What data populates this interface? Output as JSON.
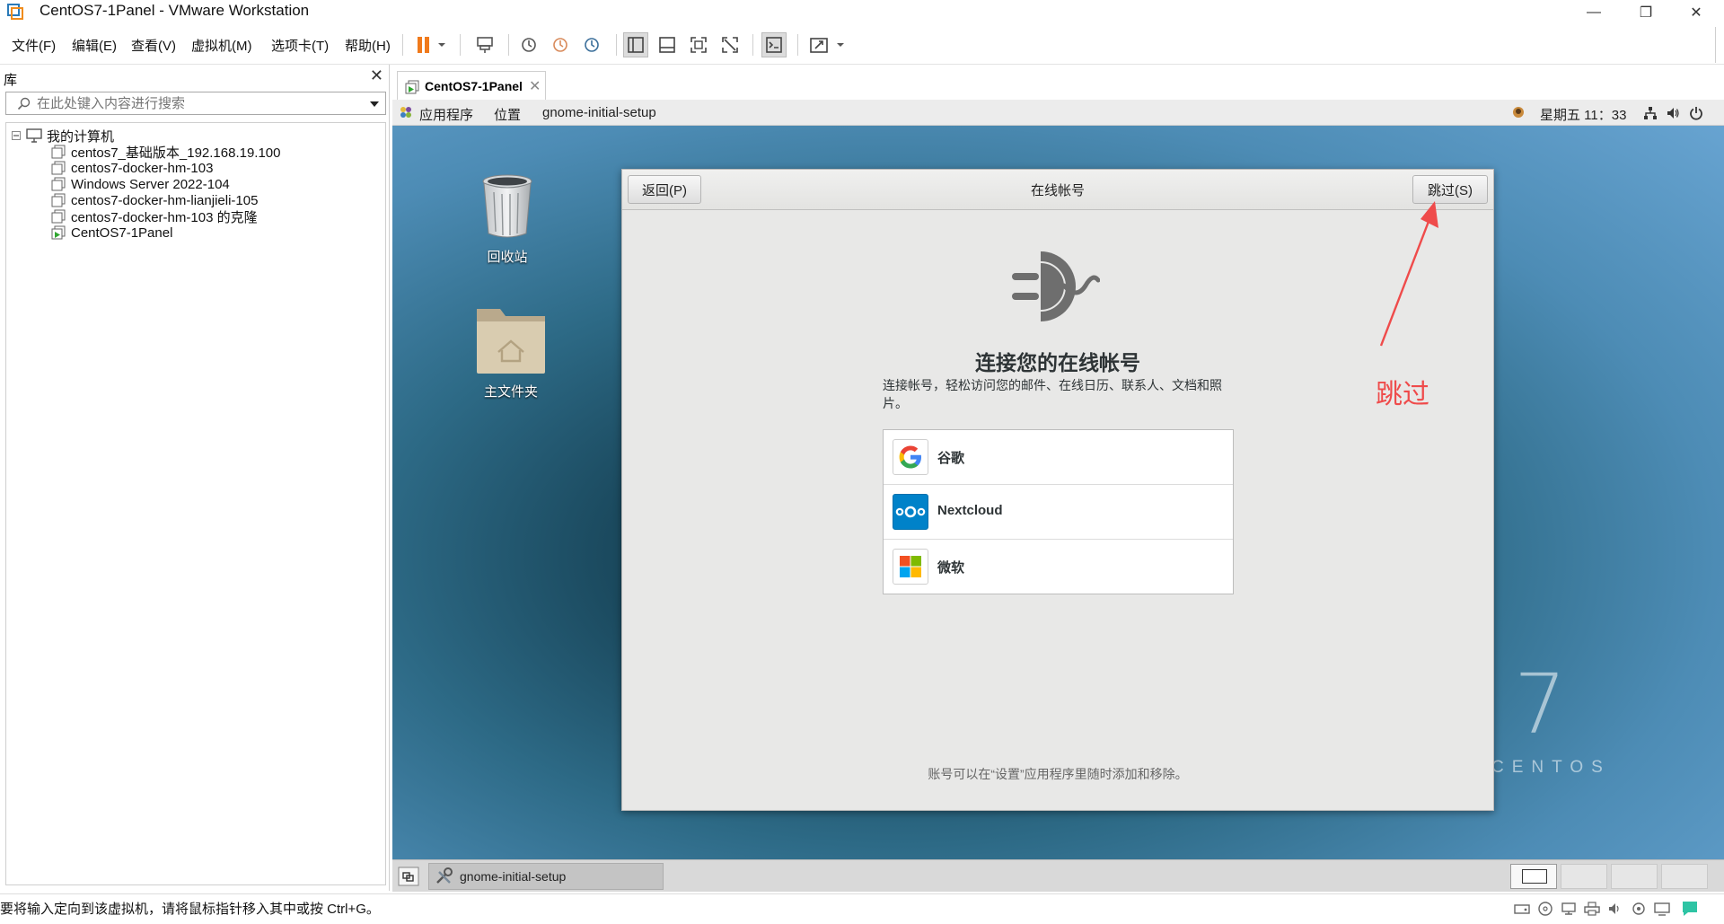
{
  "window": {
    "title": "CentOS7-1Panel - VMware Workstation",
    "minimize": "—",
    "restore": "❐",
    "close": "✕"
  },
  "menu": {
    "items": [
      "文件(F)",
      "编辑(E)",
      "查看(V)",
      "虚拟机(M)",
      "选项卡(T)",
      "帮助(H)"
    ]
  },
  "library": {
    "title": "库",
    "close": "✕",
    "search_placeholder": "在此处键入内容进行搜索",
    "root": "我的计算机",
    "items": [
      {
        "label": "centos7_基础版本_192.168.19.100",
        "running": false
      },
      {
        "label": "centos7-docker-hm-103",
        "running": false
      },
      {
        "label": "Windows Server 2022-104",
        "running": false
      },
      {
        "label": "centos7-docker-hm-lianjieli-105",
        "running": false
      },
      {
        "label": "centos7-docker-hm-103 的克隆",
        "running": false
      },
      {
        "label": "CentOS7-1Panel",
        "running": true
      }
    ]
  },
  "tab": {
    "label": "CentOS7-1Panel",
    "close": "✕"
  },
  "gnome_panel": {
    "apps": "应用程序",
    "places": "位置",
    "current_app": "gnome-initial-setup",
    "clock": "星期五 11：33"
  },
  "desktop": {
    "trash_label": "回收站",
    "home_label": "主文件夹",
    "centos_number": "7",
    "centos_word": "CENTOS"
  },
  "dialog": {
    "back": "返回(P)",
    "title": "在线帐号",
    "skip": "跳过(S)",
    "heading": "连接您的在线帐号",
    "description": "连接帐号，轻松访问您的邮件、在线日历、联系人、文档和照片。",
    "accounts": [
      "谷歌",
      "Nextcloud",
      "微软"
    ],
    "footer": "账号可以在“设置”应用程序里随时添加和移除。"
  },
  "annotation": {
    "text": "跳过",
    "color": "#ef4b4b"
  },
  "guest_taskbar": {
    "task": "gnome-initial-setup"
  },
  "statusbar": {
    "message": "要将输入定向到该虚拟机，请将鼠标指针移入其中或按 Ctrl+G。"
  }
}
